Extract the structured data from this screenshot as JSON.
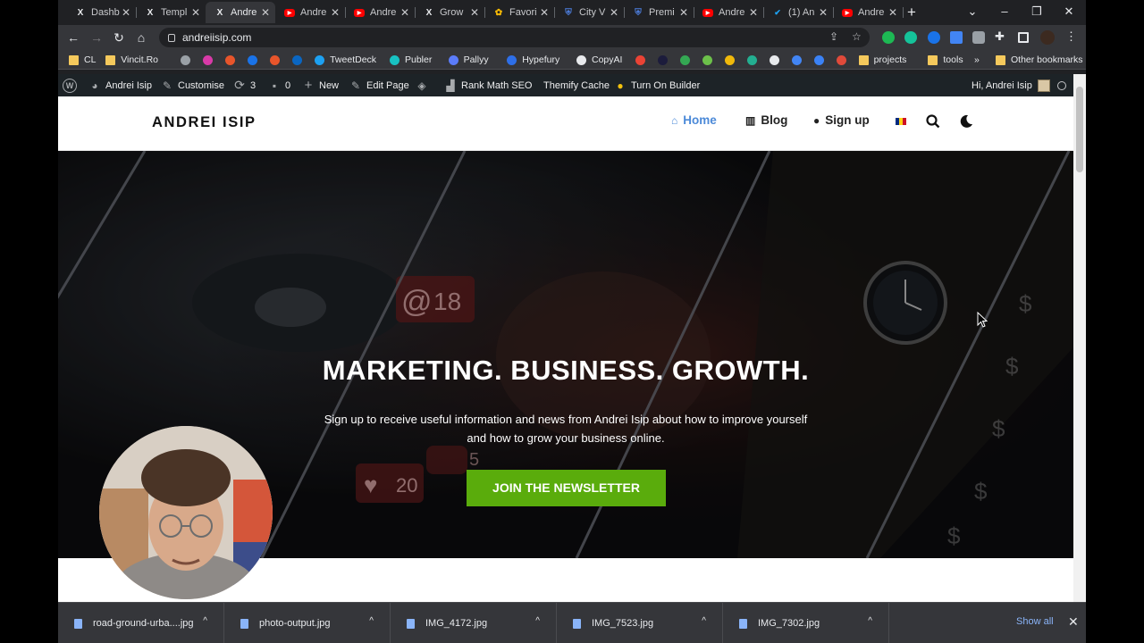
{
  "browser": {
    "tabs": [
      {
        "title": "Dashb",
        "icon": "x-logo-icon",
        "active": false
      },
      {
        "title": "Templ",
        "icon": "x-logo-icon",
        "active": false
      },
      {
        "title": "Andre",
        "icon": "x-logo-icon",
        "active": true
      },
      {
        "title": "Andre",
        "icon": "youtube-icon",
        "active": false
      },
      {
        "title": "Andre",
        "icon": "youtube-icon",
        "active": false
      },
      {
        "title": "Grow",
        "icon": "x-logo-icon",
        "active": false
      },
      {
        "title": "Favori",
        "icon": "pinwheel-icon",
        "active": false
      },
      {
        "title": "City V",
        "icon": "shield-icon",
        "active": false
      },
      {
        "title": "Premi",
        "icon": "shield-icon",
        "active": false
      },
      {
        "title": "Andre",
        "icon": "youtube-icon",
        "active": false
      },
      {
        "title": "(1) An",
        "icon": "twitter-icon",
        "active": false
      },
      {
        "title": "Andre",
        "icon": "youtube-icon",
        "active": false
      }
    ],
    "new_tab": "+",
    "url": "andreiisip.com",
    "bookmarks": [
      {
        "label": "CL",
        "icon": "folder"
      },
      {
        "label": "Vincit.Ro",
        "icon": "folder"
      },
      {
        "label": "",
        "icon": "globe"
      },
      {
        "label": "",
        "icon": "app-pink"
      },
      {
        "label": "",
        "icon": "link-orange"
      },
      {
        "label": "",
        "icon": "circle-blue"
      },
      {
        "label": "",
        "icon": "link-orange"
      },
      {
        "label": "",
        "icon": "linkedin"
      },
      {
        "label": "TweetDeck",
        "icon": "twitter"
      },
      {
        "label": "Publer",
        "icon": "publer"
      },
      {
        "label": "Pallyy",
        "icon": "pallyy"
      },
      {
        "label": "Hypefury",
        "icon": "hypefury"
      },
      {
        "label": "CopyAI",
        "icon": "copyai"
      },
      {
        "label": "",
        "icon": "gmail"
      },
      {
        "label": "",
        "icon": "s-dark"
      },
      {
        "label": "",
        "icon": "drive"
      },
      {
        "label": "",
        "icon": "green-eye"
      },
      {
        "label": "",
        "icon": "binance"
      },
      {
        "label": "",
        "icon": "kucoin"
      },
      {
        "label": "",
        "icon": "x-black"
      },
      {
        "label": "",
        "icon": "calendar"
      },
      {
        "label": "",
        "icon": "dollar"
      },
      {
        "label": "",
        "icon": "red-file"
      },
      {
        "label": "projects",
        "icon": "folder"
      },
      {
        "label": "tools",
        "icon": "folder"
      }
    ],
    "bookmarks_more": "»",
    "other_bookmarks": "Other bookmarks"
  },
  "wp_admin": {
    "site_name": "Andrei Isip",
    "customise": "Customise",
    "updates": "3",
    "comments": "0",
    "new": "New",
    "edit_page": "Edit Page",
    "rank_math": "Rank Math SEO",
    "themify_cache": "Themify Cache",
    "turn_on_builder": "Turn On Builder",
    "greeting": "Hi, Andrei Isip"
  },
  "site": {
    "logo": "ANDREI ISIP",
    "menu": [
      {
        "label": "Home",
        "icon": "home-icon",
        "active": true
      },
      {
        "label": "Blog",
        "icon": "book-icon",
        "active": false
      },
      {
        "label": "Sign up",
        "icon": "user-icon",
        "active": false
      }
    ],
    "hero": {
      "headline": "MARKETING. BUSINESS. GROWTH.",
      "subtitle": "Sign up to receive useful information and news from Andrei Isip about how to improve yourself and how to grow your business online.",
      "cta": "JOIN THE NEWSLETTER",
      "badges": {
        "mentions": "18",
        "likes": "20",
        "comments": "5"
      }
    }
  },
  "downloads": {
    "files": [
      "road-ground-urba....jpg",
      "photo-output.jpg",
      "IMG_4172.jpg",
      "IMG_7523.jpg",
      "IMG_7302.jpg"
    ],
    "show_all": "Show all"
  },
  "colors": {
    "accent_blue": "#4c8ad8",
    "cta_green": "#5aac0c",
    "wp_bar": "#1d2327",
    "chrome_dark": "#202124"
  }
}
